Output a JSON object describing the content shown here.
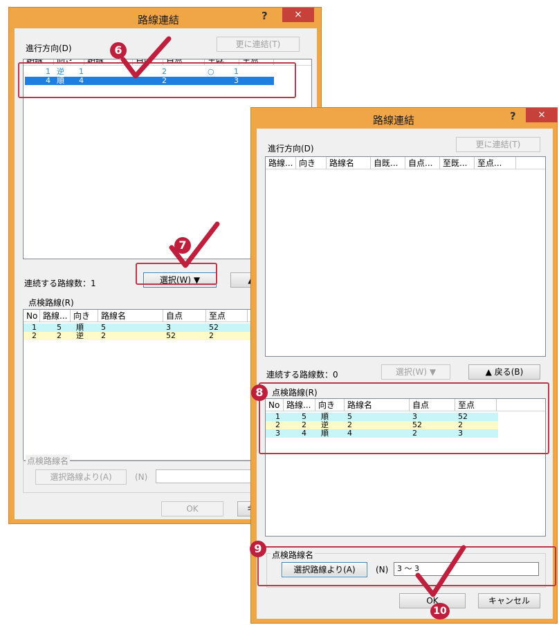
{
  "dialog1": {
    "title": "路線連結",
    "help": "?",
    "close": "×",
    "direction_label": "進行方向(D)",
    "more_connect_btn": "更に連結(T)",
    "columns": [
      "路線",
      "向き",
      "路線",
      "自既",
      "自点",
      "至既",
      "至点"
    ],
    "rows": [
      [
        "1",
        "逆",
        "1",
        "",
        "2",
        "○",
        "1"
      ],
      [
        "4",
        "順",
        "4",
        "",
        "2",
        "",
        "3"
      ]
    ],
    "count_label": "連続する路線数：1",
    "select_btn": "選択(W) ▼",
    "back_btn": "▲",
    "inspect_label": "点検路線(R)",
    "inspect_columns": [
      "No",
      "路線...",
      "向き",
      "路線名",
      "自点",
      "至点"
    ],
    "inspect_rows": [
      [
        "1",
        "5",
        "順",
        "5",
        "3",
        "52"
      ],
      [
        "2",
        "2",
        "逆",
        "2",
        "52",
        "2"
      ]
    ],
    "name_group": "点検路線名",
    "from_selected_btn": "選択路線より(A)",
    "n_label": "(N)",
    "ok_btn": "OK",
    "cancel_btn": "キ"
  },
  "dialog2": {
    "title": "路線連結",
    "help": "?",
    "close": "×",
    "direction_label": "進行方向(D)",
    "more_connect_btn": "更に連結(T)",
    "columns": [
      "路線...",
      "向き",
      "路線名",
      "自既...",
      "自点...",
      "至既...",
      "至点..."
    ],
    "count_label": "連続する路線数：0",
    "select_btn": "選択(W) ▼",
    "back_btn": "▲ 戻る(B)",
    "inspect_label": "点検路線(R)",
    "inspect_columns": [
      "No",
      "路線...",
      "向き",
      "路線名",
      "自点",
      "至点"
    ],
    "inspect_rows": [
      [
        "1",
        "5",
        "順",
        "5",
        "3",
        "52"
      ],
      [
        "2",
        "2",
        "逆",
        "2",
        "52",
        "2"
      ],
      [
        "3",
        "4",
        "順",
        "4",
        "2",
        "3"
      ]
    ],
    "name_group": "点検路線名",
    "from_selected_btn": "選択路線より(A)",
    "n_label": "(N)",
    "name_value": "3 ～ 3",
    "ok_btn": "OK",
    "cancel_btn": "キャンセル"
  },
  "annotations": {
    "step6": "6",
    "step7": "7",
    "step8": "8",
    "step9": "9",
    "step10": "10",
    "highlight_color": "#b8384a",
    "badge_color": "#bf1e3c",
    "selected_row_color": "#1e7fe0",
    "row_cyan": "#c8f5f8",
    "row_yellow": "#fffbc8"
  }
}
